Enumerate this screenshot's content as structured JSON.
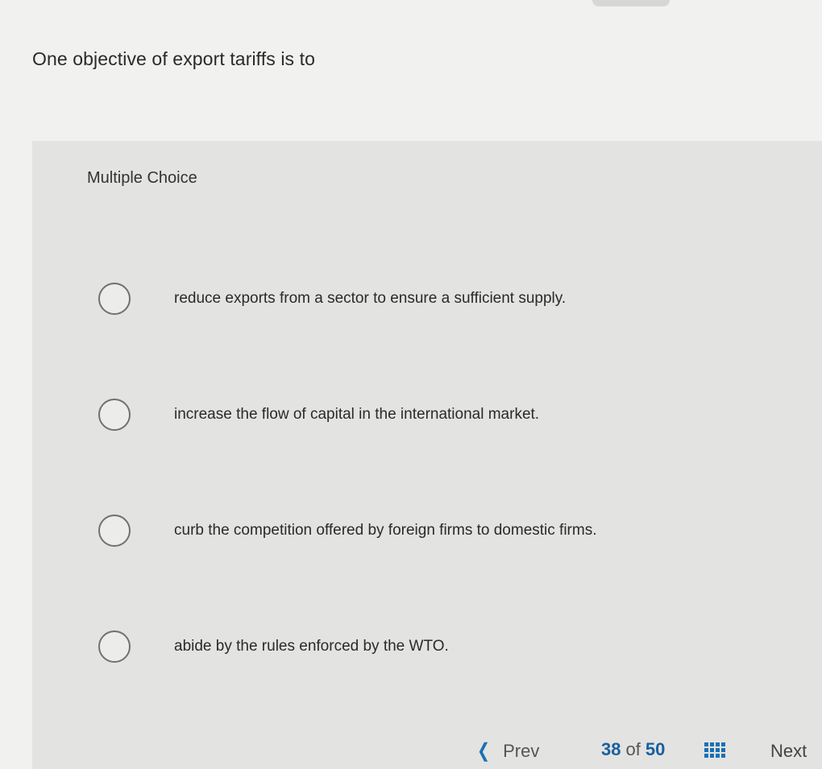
{
  "question": {
    "text": "One objective of export tariffs is to"
  },
  "question_type": "Multiple Choice",
  "choices": [
    {
      "label": "reduce exports from a sector to ensure a sufficient supply."
    },
    {
      "label": "increase the flow of capital in the international market."
    },
    {
      "label": "curb the competition offered by foreign firms to domestic firms."
    },
    {
      "label": "abide by the rules enforced by the WTO."
    }
  ],
  "navigation": {
    "prev_label": "Prev",
    "current_page": "38",
    "of_label": "of",
    "total_pages": "50",
    "next_label": "Next",
    "prev_icon": "chevron-left-icon",
    "grid_icon": "grid-icon"
  },
  "colors": {
    "accent": "#1a6fb5",
    "text": "#2a2a2a",
    "panel": "#e3e3e1",
    "background": "#f1f1ef"
  }
}
